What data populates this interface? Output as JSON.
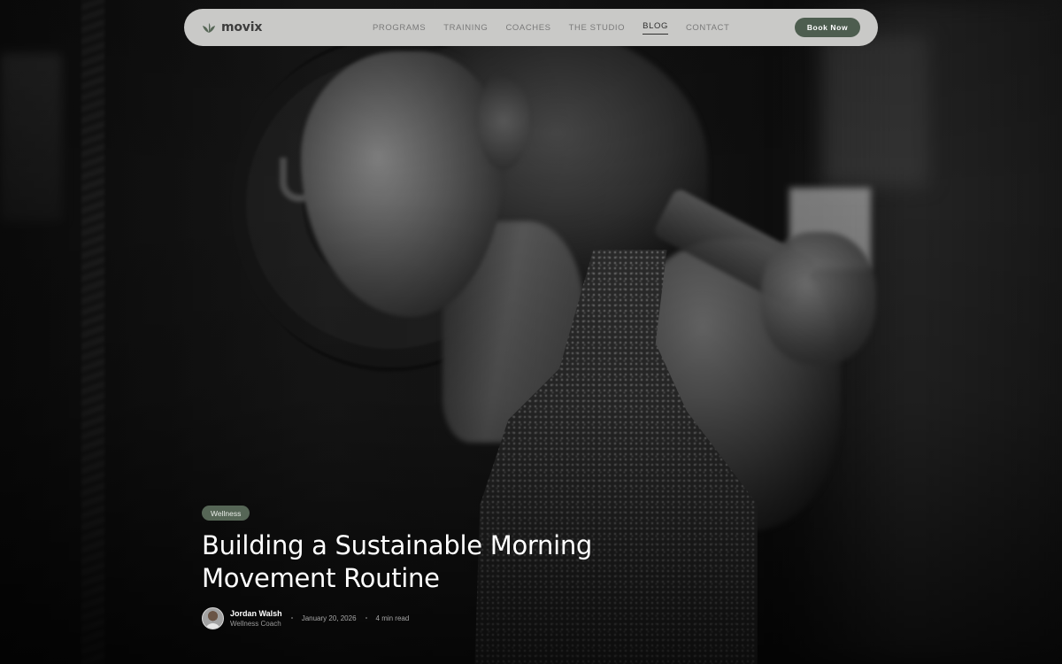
{
  "nav": {
    "brand": "movix",
    "items": [
      {
        "label": "PROGRAMS",
        "active": false
      },
      {
        "label": "TRAINING",
        "active": false
      },
      {
        "label": "COACHES",
        "active": false
      },
      {
        "label": "THE STUDIO",
        "active": false
      },
      {
        "label": "BLOG",
        "active": true
      },
      {
        "label": "CONTACT",
        "active": false
      }
    ],
    "cta": "Book Now"
  },
  "article": {
    "category": "Wellness",
    "title": "Building a Sustainable Morning Movement Routine",
    "author": {
      "name": "Jordan Walsh",
      "role": "Wellness Coach"
    },
    "date": "January 20, 2026",
    "read_time": "4 min read"
  },
  "colors": {
    "accent": "#4d5d4f",
    "tag": "#566656",
    "nav_bg": "#c9c9c7"
  },
  "icons": {
    "logo": "leaf-icon"
  }
}
